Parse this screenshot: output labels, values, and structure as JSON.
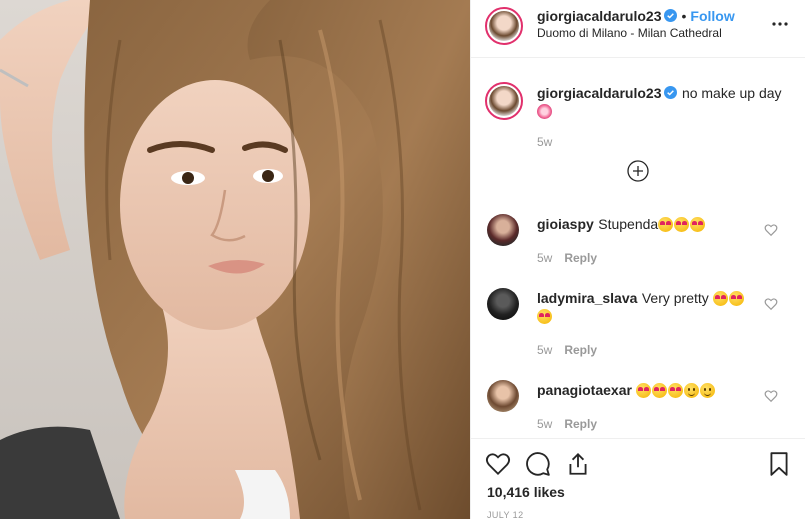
{
  "post": {
    "author": "giorgiacaldarulo23",
    "follow_label": "Follow",
    "dot": "•",
    "location": "Duomo di Milano - Milan Cathedral"
  },
  "caption": {
    "author": "giorgiacaldarulo23",
    "text": "no make up day",
    "time": "5w"
  },
  "comments": [
    {
      "user": "gioiaspy",
      "text": "Stupenda",
      "time": "5w",
      "reply": "Reply"
    },
    {
      "user": "ladymira_slava",
      "text": "Very pretty",
      "time": "5w",
      "reply": "Reply"
    },
    {
      "user": "panagiotaexar",
      "text": "",
      "time": "5w",
      "reply": "Reply"
    }
  ],
  "likes": "10,416 likes",
  "date": "JULY 12",
  "icons": [
    "more-options-icon",
    "verified-badge-icon",
    "load-more-comments-icon",
    "heart-icon",
    "comment-icon",
    "share-icon",
    "bookmark-icon"
  ],
  "colors": {
    "follow": "#3897f0",
    "story_ring": "#e1306c",
    "verified": "#3897f0",
    "muted": "#999999"
  }
}
